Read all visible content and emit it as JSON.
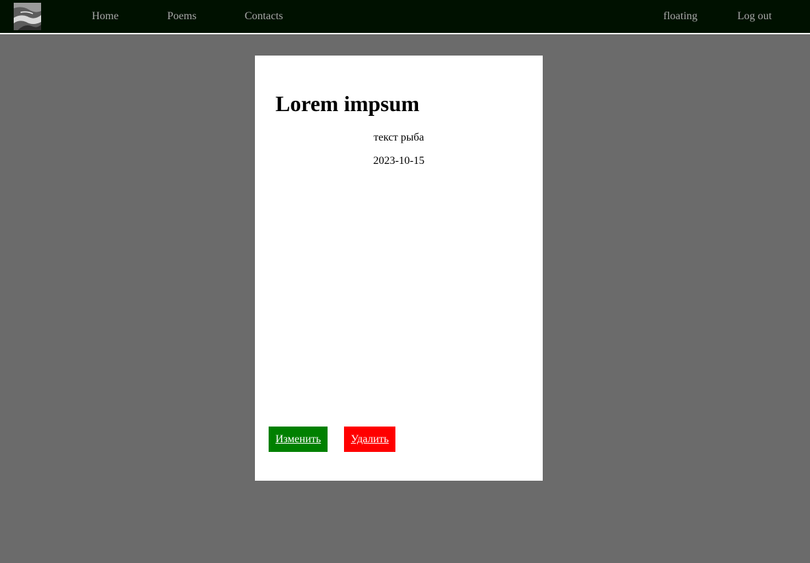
{
  "nav": {
    "home": "Home",
    "poems": "Poems",
    "contacts": "Contacts",
    "username": "floating",
    "logout": "Log out"
  },
  "post": {
    "title": "Lorem impsum",
    "text": "текст рыба",
    "date": "2023-10-15",
    "edit_label": "Изменить",
    "delete_label": "Удалить"
  },
  "colors": {
    "navbar_bg": "#001100",
    "page_bg": "#6b6b6b",
    "edit_button": "#008000",
    "delete_button": "#ff0000"
  },
  "icons": {
    "logo": "landscape-photo-logo"
  }
}
